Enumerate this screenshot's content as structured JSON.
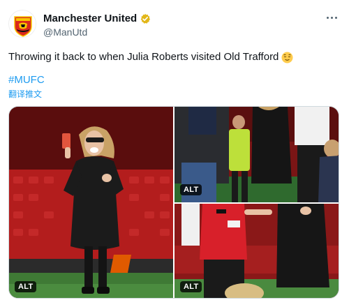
{
  "account": {
    "display_name": "Manchester United",
    "handle": "@ManUtd",
    "verified_color": "#e2b719",
    "avatar_icon": "man-utd-crest-icon"
  },
  "tweet": {
    "text": "Throwing it back to when Julia Roberts visited Old Trafford",
    "emoji": "relieved-face-emoji",
    "hashtag": "#MUFC",
    "translate_label": "翻译推文"
  },
  "media": {
    "alt_badges": [
      "ALT",
      "ALT",
      "ALT"
    ]
  },
  "colors": {
    "link": "#1d9bf0",
    "text": "#0f1419",
    "muted": "#536471",
    "club_red": "#da291c"
  }
}
